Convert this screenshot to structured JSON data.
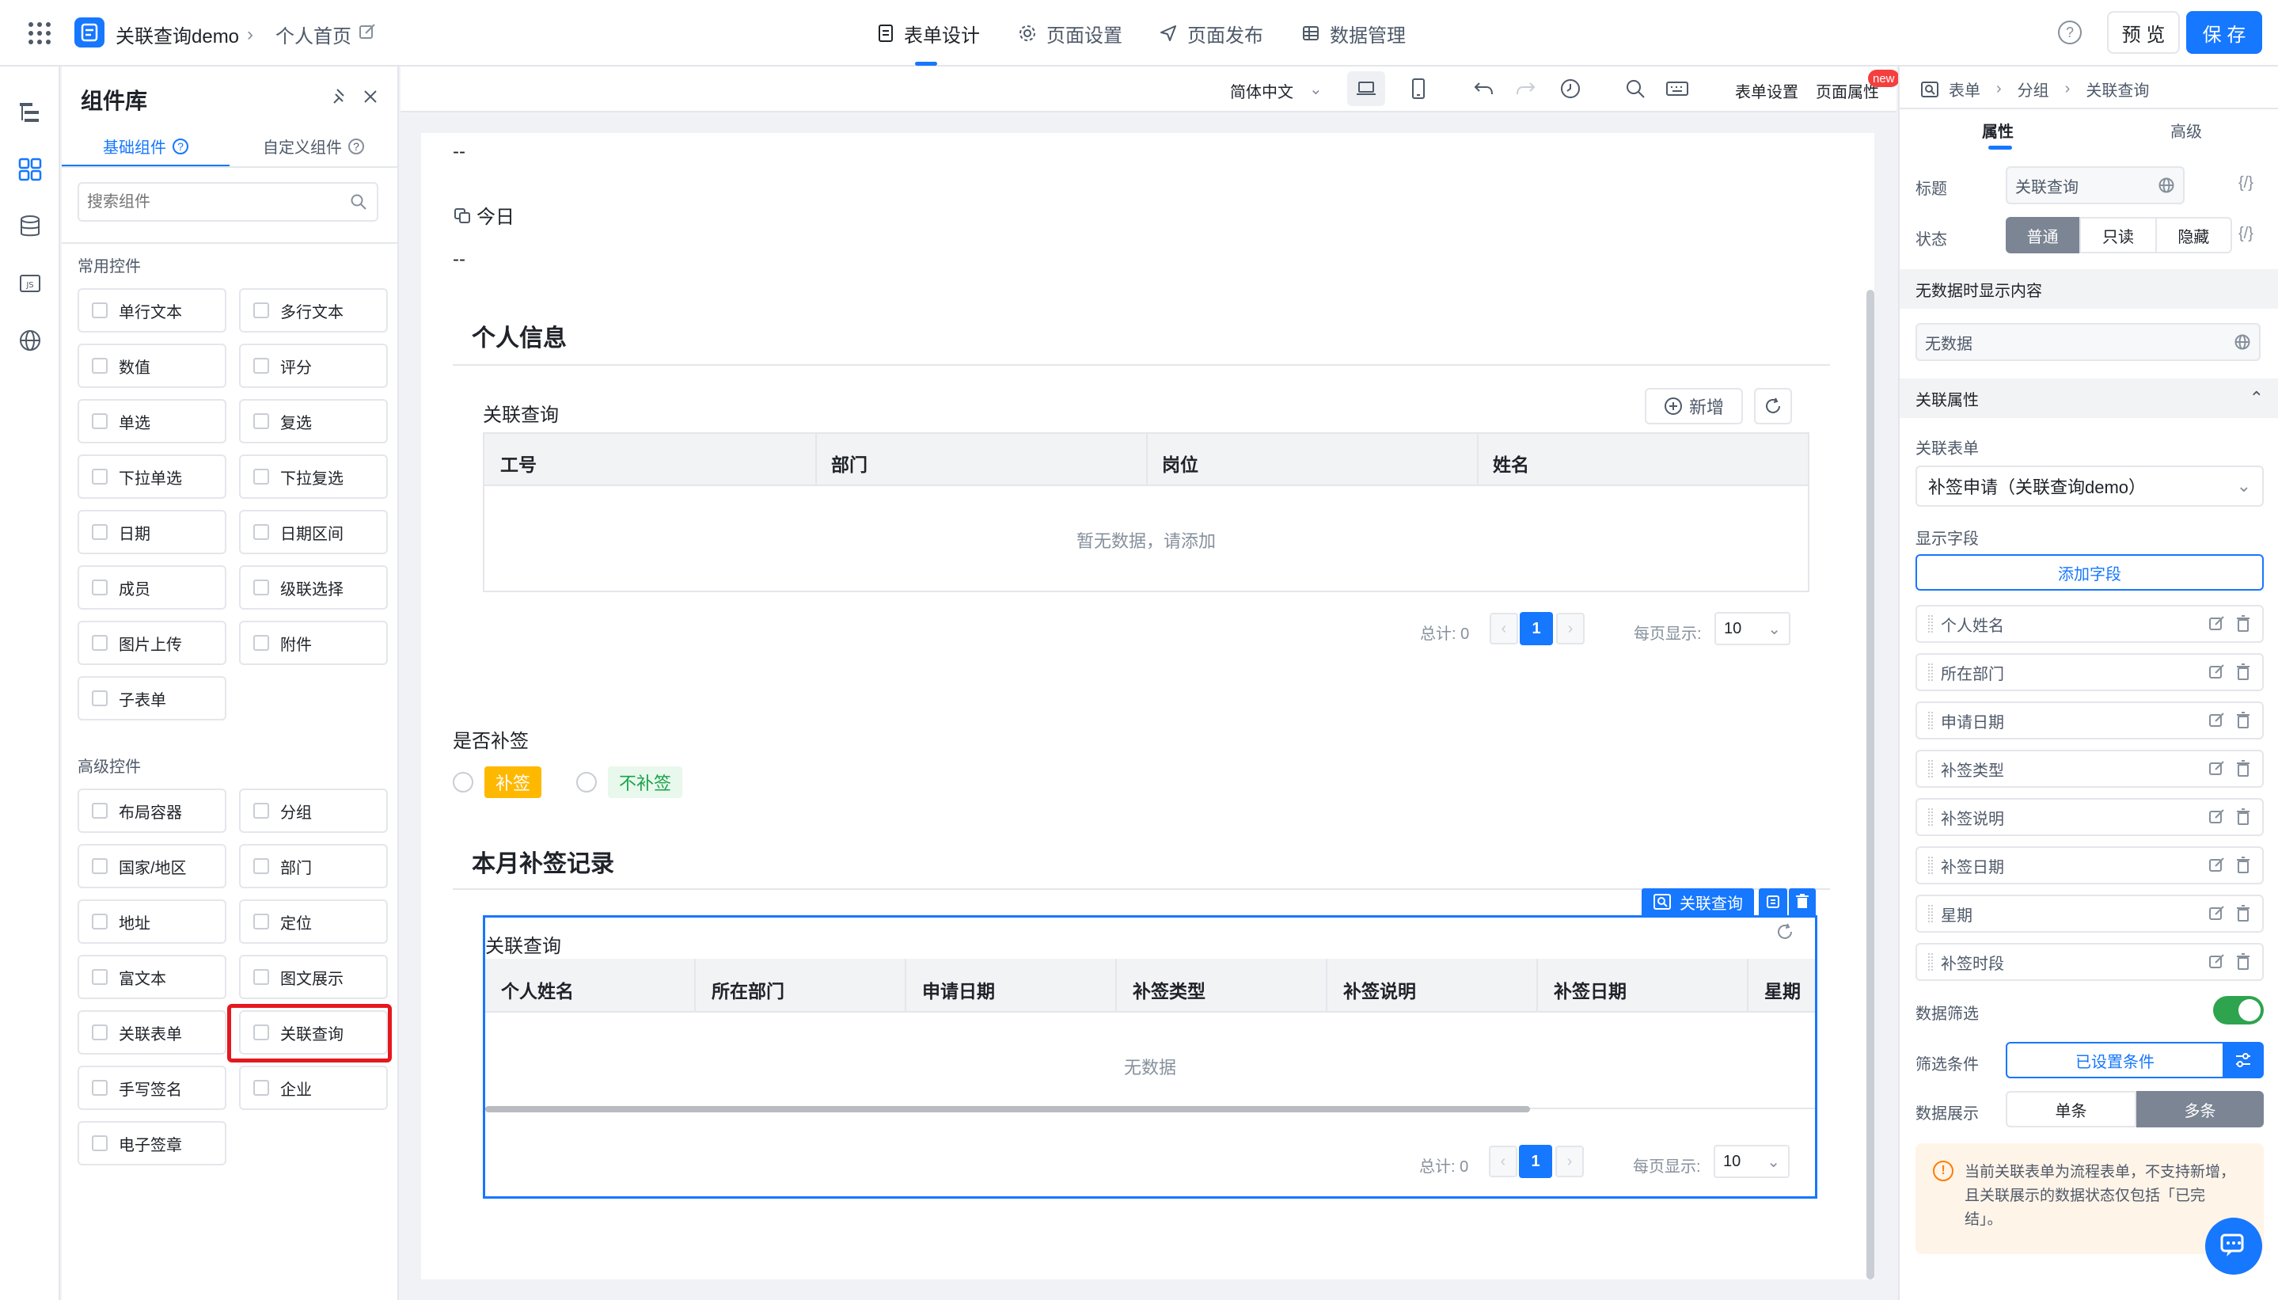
{
  "header": {
    "app_name": "关联查询demo",
    "breadcrumb_page": "个人首页",
    "nav": [
      "表单设计",
      "页面设置",
      "页面发布",
      "数据管理"
    ],
    "preview_label": "预 览",
    "save_label": "保 存"
  },
  "library": {
    "title": "组件库",
    "tabs": [
      "基础组件",
      "自定义组件"
    ],
    "search_placeholder": "搜索组件",
    "common_title": "常用控件",
    "common": [
      "单行文本",
      "多行文本",
      "数值",
      "评分",
      "单选",
      "复选",
      "下拉单选",
      "下拉复选",
      "日期",
      "日期区间",
      "成员",
      "级联选择",
      "图片上传",
      "附件",
      "子表单"
    ],
    "advanced_title": "高级控件",
    "advanced": [
      "布局容器",
      "分组",
      "国家/地区",
      "部门",
      "地址",
      "定位",
      "富文本",
      "图文展示",
      "关联表单",
      "关联查询",
      "手写签名",
      "企业",
      "电子签章"
    ]
  },
  "toolbar": {
    "language": "简体中文",
    "form_settings": "表单设置",
    "page_props": "页面属性",
    "new_badge": "new"
  },
  "canvas": {
    "dash1": "--",
    "today_label": "今日",
    "dash2": "--",
    "section1_title": "个人信息",
    "table1": {
      "title": "关联查询",
      "add_label": "新增",
      "columns": [
        "工号",
        "部门",
        "岗位",
        "姓名"
      ],
      "empty": "暂无数据，请添加",
      "total": "总计: 0",
      "page": "1",
      "per_page_label": "每页显示:",
      "per_page": "10"
    },
    "radio_group": {
      "label": "是否补签",
      "options": [
        "补签",
        "不补签"
      ]
    },
    "section2_title": "本月补签记录",
    "table2": {
      "tag": "关联查询",
      "title": "关联查询",
      "columns": [
        "个人姓名",
        "所在部门",
        "申请日期",
        "补签类型",
        "补签说明",
        "补签日期",
        "星期"
      ],
      "empty": "无数据",
      "total": "总计: 0",
      "page": "1",
      "per_page_label": "每页显示:",
      "per_page": "10"
    }
  },
  "rpanel": {
    "breadcrumb": [
      "表单",
      "分组",
      "关联查询"
    ],
    "tabs": [
      "属性",
      "高级"
    ],
    "title_label": "标题",
    "title_value": "关联查询",
    "fx": "{/}",
    "state_label": "状态",
    "states": [
      "普通",
      "只读",
      "隐藏"
    ],
    "nodata_section": "无数据时显示内容",
    "nodata_value": "无数据",
    "assoc_section": "关联属性",
    "assoc_form_label": "关联表单",
    "assoc_form_value": "补签申请（关联查询demo）",
    "display_fields_label": "显示字段",
    "add_field": "添加字段",
    "fields": [
      "个人姓名",
      "所在部门",
      "申请日期",
      "补签类型",
      "补签说明",
      "补签日期",
      "星期",
      "补签时段"
    ],
    "filter_label": "数据筛选",
    "condition_label": "筛选条件",
    "condition_value": "已设置条件",
    "display_label": "数据展示",
    "display_options": [
      "单条",
      "多条"
    ],
    "notice": [
      "当前关联表单为流程表单，不支持新增，",
      "且关联展示的数据状态仅包括「已完",
      "结」。"
    ]
  },
  "colors": {
    "primary": "#1677ff",
    "tag_warn": "#ffb800",
    "tag_green_bg": "#e8f8ec",
    "tag_green_fg": "#1aa34a",
    "highlight_red": "#e5181e",
    "switch_on": "#2ea44f"
  }
}
